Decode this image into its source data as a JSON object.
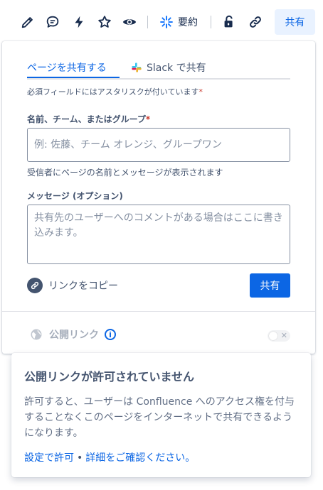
{
  "toolbar": {
    "icons": [
      "edit-icon",
      "comment-icon",
      "lightning-icon",
      "star-icon",
      "watch-icon",
      "unlock-icon",
      "link-icon"
    ],
    "summary_label": "要約",
    "share_label": "共有"
  },
  "share_panel": {
    "tabs": [
      {
        "label": "ページを共有する",
        "active": true
      },
      {
        "label": "Slack で共有",
        "active": false
      }
    ],
    "required_note": "必須フィールドにはアスタリスクが付いています",
    "required_star": "*",
    "recipients_label": "名前、チーム、またはグループ",
    "recipients_placeholder": "例: 佐藤、チーム オレンジ、グループワン",
    "recipients_helper": "受信者にページの名前とメッセージが表示されます",
    "message_label": "メッセージ (オプション)",
    "message_placeholder": "共有先のユーザーへのコメントがある場合はここに書き込みます。",
    "copy_link_label": "リンクをコピー",
    "share_button_label": "共有",
    "public_link_label": "公開リンク",
    "public_link_enabled": false
  },
  "tooltip_card": {
    "title": "公開リンクが許可されていません",
    "body": "許可すると、ユーザーは Confluence へのアクセス権を付与することなくこのページをインターネットで共有できるようになります。",
    "link_settings": "設定で許可",
    "separator": "•",
    "link_details": "詳細をご確認ください。"
  },
  "colors": {
    "accent": "#0c66e4",
    "accent_light": "#e9f2ff",
    "text": "#172b4d",
    "subtle": "#44546f"
  }
}
